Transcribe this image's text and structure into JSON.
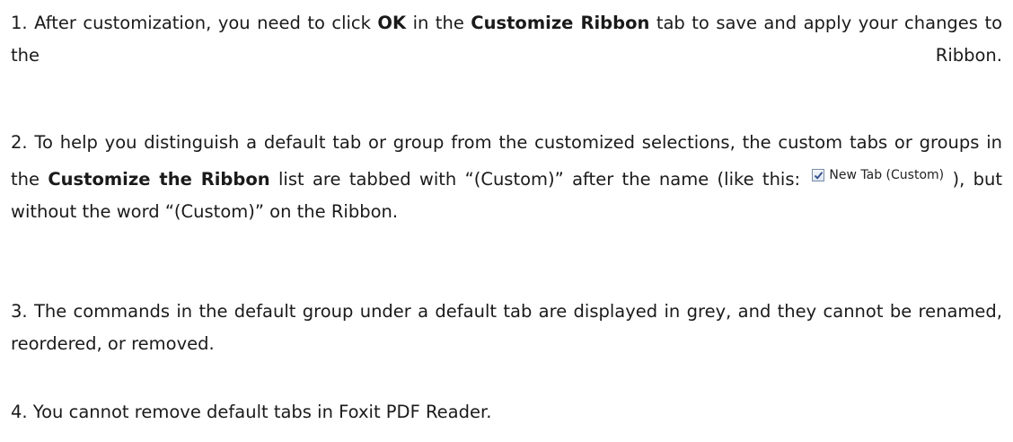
{
  "paragraphs": [
    {
      "number": "1.",
      "text_1": " After customization, you need to click ",
      "bold_1": "OK",
      "text_2": " in the ",
      "bold_2": "Customize Ribbon",
      "text_3": " tab to save and apply your changes to the Ribbon."
    },
    {
      "number": "2.",
      "text_1": " To help you distinguish a default tab or group from the customized selections, the custom tabs or groups in the ",
      "bold_1": "Customize the Ribbon",
      "text_2": " list are tabbed with “(Custom)” after the name (like this: ",
      "widget_label": "New Tab (Custom)",
      "widget_checked": true,
      "text_3": " ), but without the word “(Custom)” on the Ribbon."
    },
    {
      "number": "3.",
      "text_1": " The commands in the default group under a default tab are displayed in grey, and they cannot be renamed, reordered, or removed."
    },
    {
      "number": "4.",
      "text_1": " You cannot remove default tabs in Foxit PDF Reader."
    }
  ],
  "colors": {
    "text": "#1a1a1a",
    "checkbox_border": "#7a8ca6",
    "checkmark": "#2b4a8a"
  },
  "icons": {
    "checkbox": "checked-checkbox-icon"
  }
}
